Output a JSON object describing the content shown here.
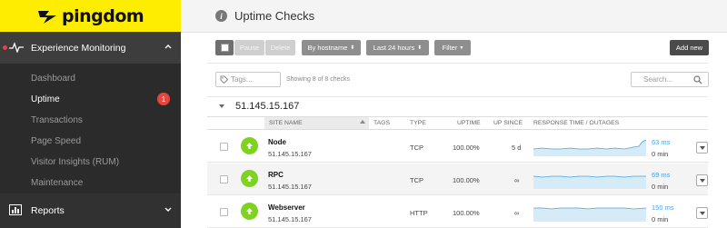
{
  "app": {
    "logo_text": "pingdom",
    "brand_color": "#ffed00"
  },
  "sidebar": {
    "section": {
      "label": "Experience Monitoring",
      "icon": "pulse-icon"
    },
    "items": [
      {
        "label": "Dashboard"
      },
      {
        "label": "Uptime",
        "badge": "1",
        "active": true
      },
      {
        "label": "Transactions"
      },
      {
        "label": "Page Speed"
      },
      {
        "label": "Visitor Insights (RUM)"
      },
      {
        "label": "Maintenance"
      }
    ],
    "reports": {
      "label": "Reports",
      "icon": "bar-chart-icon"
    }
  },
  "header": {
    "title": "Uptime Checks",
    "icon": "info-icon"
  },
  "toolbar": {
    "pause_label": "Pause",
    "delete_label": "Delete",
    "group_by_label": "By hostname",
    "range_label": "Last 24 hours",
    "filter_label": "Filter",
    "add_new_label": "Add new"
  },
  "filters": {
    "tags_placeholder": "Tags...",
    "showing_text": "Showing 8 of 8 checks",
    "search_placeholder": "Search..."
  },
  "group": {
    "name": "51.145.15.167"
  },
  "columns": {
    "site_name": "SITE NAME",
    "tags": "TAGS",
    "type": "TYPE",
    "uptime": "UPTIME",
    "up_since": "UP SINCE",
    "response": "RESPONSE TIME / OUTAGES"
  },
  "rows": [
    {
      "name": "Node",
      "host": "51.145.15.167",
      "type": "TCP",
      "uptime": "100.00%",
      "up_since": "5 d",
      "response_time": "63 ms",
      "outages": "0 min",
      "status": "up"
    },
    {
      "name": "RPC",
      "host": "51.145.15.167",
      "type": "TCP",
      "uptime": "100.00%",
      "up_since": "∞",
      "response_time": "69 ms",
      "outages": "0 min",
      "status": "up"
    },
    {
      "name": "Webserver",
      "host": "51.145.15.167",
      "type": "HTTP",
      "uptime": "100.00%",
      "up_since": "∞",
      "response_time": "150 ms",
      "outages": "0 min",
      "status": "up"
    }
  ],
  "colors": {
    "status_up": "#7ed321",
    "alert": "#e8453c",
    "link": "#4aa3df",
    "sparkline": "#4aa3df"
  }
}
